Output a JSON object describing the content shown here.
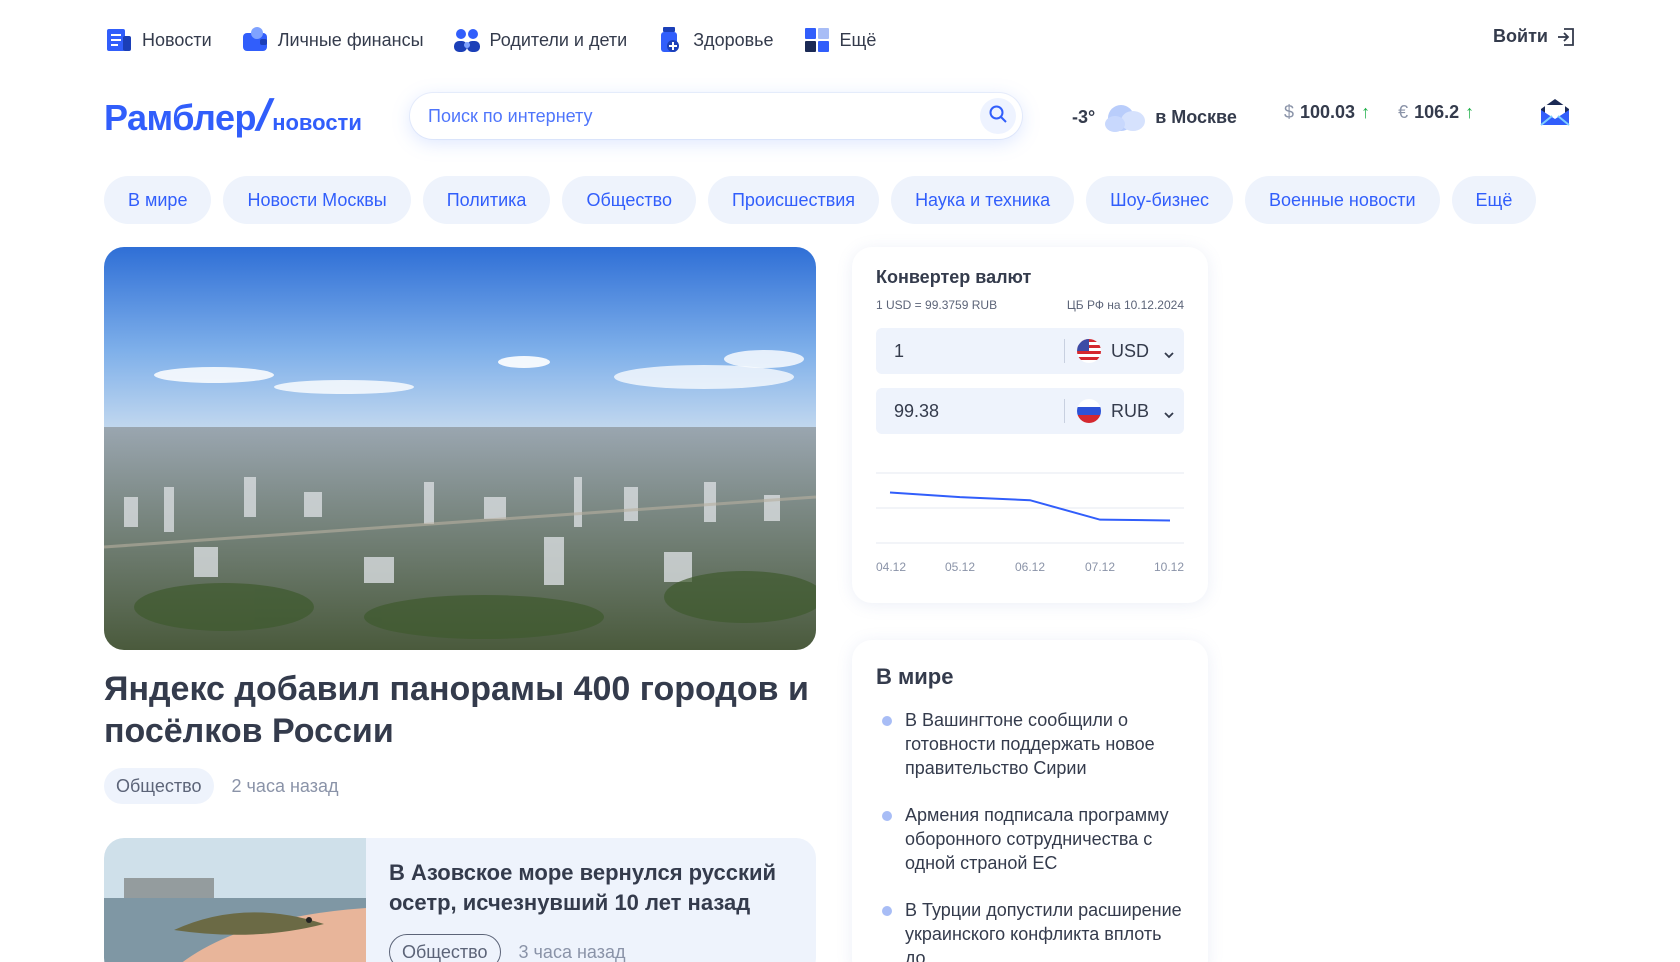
{
  "topnav": {
    "items": [
      {
        "label": "Новости",
        "icon": "newspaper-icon"
      },
      {
        "label": "Личные финансы",
        "icon": "wallet-icon"
      },
      {
        "label": "Родители и дети",
        "icon": "family-icon"
      },
      {
        "label": "Здоровье",
        "icon": "medicine-icon"
      },
      {
        "label": "Ещё",
        "icon": "grid-icon"
      }
    ],
    "login_label": "Войти"
  },
  "header": {
    "logo_brand": "Рамблер",
    "logo_slash": "/",
    "logo_section": "новости",
    "search_placeholder": "Поиск по интернету",
    "weather": {
      "temp": "-3°",
      "city": "в Москве",
      "icon": "cloud-icon"
    },
    "rates": [
      {
        "symbol": "$",
        "value": "100.03",
        "trend": "↑"
      },
      {
        "symbol": "€",
        "value": "106.2",
        "trend": "↑"
      }
    ],
    "mail_icon": "mail-icon"
  },
  "categories": [
    "В мире",
    "Новости Москвы",
    "Политика",
    "Общество",
    "Происшествия",
    "Наука и техника",
    "Шоу-бизнес",
    "Военные новости",
    "Ещё"
  ],
  "hero": {
    "title": "Яндекс добавил панорамы 400 городов и посёлков России",
    "tag": "Общество",
    "time": "2 часа назад"
  },
  "second_article": {
    "title": "В Азовское море вернулся русский осетр, исчезнувший 10 лет назад",
    "tag": "Общество",
    "time": "3 часа назад"
  },
  "converter": {
    "title": "Конвертер валют",
    "rate_line": "1 USD = 99.3759 RUB",
    "source_line": "ЦБ РФ на 10.12.2024",
    "from": {
      "value": "1",
      "currency": "USD"
    },
    "to": {
      "value": "99.38",
      "currency": "RUB"
    },
    "chart_dates": [
      "04.12",
      "05.12",
      "06.12",
      "07.12",
      "10.12"
    ]
  },
  "chart_data": {
    "type": "line",
    "categories": [
      "04.12",
      "05.12",
      "06.12",
      "07.12",
      "10.12"
    ],
    "values": [
      103.5,
      102.9,
      102.5,
      100.0,
      99.9
    ],
    "ylim": [
      97,
      106
    ],
    "grid": true,
    "color": "#315efb"
  },
  "world": {
    "title": "В мире",
    "items": [
      "В Вашингтоне сообщили о готовности поддержать новое правительство Сирии",
      "Армения подписала программу оборонного сотрудничества с одной страной ЕС",
      "В Турции допустили расширение украинского конфликта вплоть до"
    ]
  },
  "colors": {
    "accent": "#315efb",
    "chip_bg": "#eef3fc",
    "text": "#343b4c",
    "trend_up": "#22b14c"
  }
}
